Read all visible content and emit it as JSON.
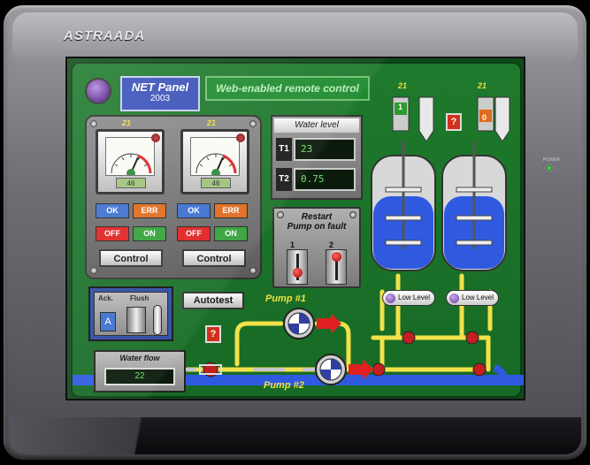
{
  "device": {
    "brand": "ASTRAADA",
    "power_label": "POWER"
  },
  "header": {
    "net_panel_title": "NET Panel",
    "net_panel_year": "2003",
    "web_label": "Web-enabled remote control"
  },
  "gauges": [
    {
      "channel": "21",
      "value": "46"
    },
    {
      "channel": "21",
      "value": "46"
    }
  ],
  "buttons": {
    "ok": "OK",
    "err": "ERR",
    "off": "OFF",
    "on": "ON",
    "control": "Control",
    "autotest": "Autotest",
    "ack": "A",
    "question": "?"
  },
  "water_level": {
    "title": "Water level",
    "t1_label": "T1",
    "t1_value": "23",
    "t2_label": "T2",
    "t2_value": "0.75"
  },
  "restart": {
    "title_line1": "Restart",
    "title_line2": "Pump on fault",
    "switch1": "1",
    "switch2": "2"
  },
  "ack_flush": {
    "ack_label": "Ack.",
    "flush_label": "Flush"
  },
  "water_flow": {
    "title": "Water flow",
    "value": "22"
  },
  "pumps": {
    "pump1": "Pump #1",
    "pump2": "Pump #2"
  },
  "tanks": [
    {
      "channel": "21",
      "indicator": "1",
      "low_level": "Low Level",
      "level_fraction": 0.55
    },
    {
      "channel": "21",
      "indicator": "0",
      "low_level": "Low Level",
      "level_fraction": 0.55
    }
  ],
  "colors": {
    "screen_bg": "#1e7a2c",
    "pipe": "#f2e24a",
    "water": "#2f5ae0",
    "arrow": "#e02020"
  }
}
